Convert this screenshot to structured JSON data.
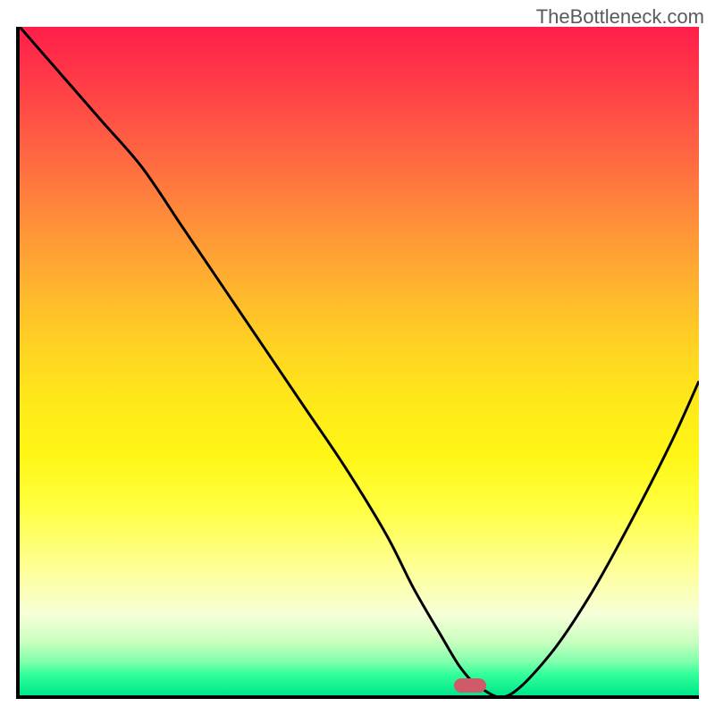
{
  "watermark": "TheBottleneck.com",
  "chart_data": {
    "type": "line",
    "title": "",
    "xlabel": "",
    "ylabel": "",
    "x_range": [
      0,
      100
    ],
    "y_range": [
      0,
      100
    ],
    "series": [
      {
        "name": "bottleneck-curve",
        "x": [
          0,
          6,
          12,
          18,
          24,
          30,
          36,
          42,
          48,
          54,
          58,
          62,
          65,
          68,
          72,
          78,
          84,
          90,
          96,
          100
        ],
        "y": [
          100,
          93,
          86,
          79,
          70,
          61,
          52,
          43,
          34,
          24,
          16,
          9,
          4,
          1,
          0,
          6,
          15,
          26,
          38,
          47
        ]
      }
    ],
    "annotations": [
      {
        "name": "optimal-marker",
        "x": 66,
        "y": 2
      }
    ],
    "background": "vertical-gradient-red-to-green"
  }
}
